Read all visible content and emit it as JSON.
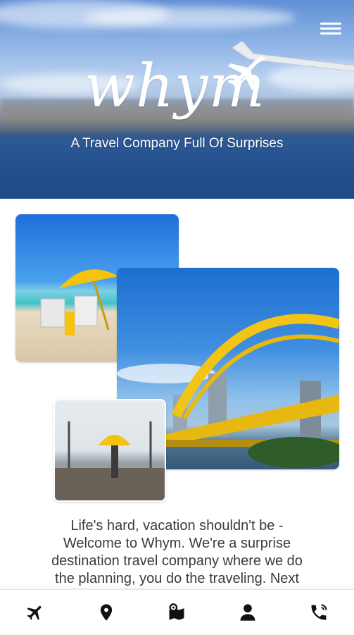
{
  "header": {
    "logo_text": "whym",
    "tagline": "A Travel Company Full Of Surprises",
    "menu_icon": "hamburger-menu-icon"
  },
  "gallery": {
    "images": [
      "beach-umbrella-photo",
      "yellow-bridge-photo",
      "pier-yellow-umbrella-photo"
    ]
  },
  "intro": {
    "lines": [
      "Life's hard, vacation shouldn't be -",
      "Welcome to Whym. We're a surprise",
      "destination travel company where we do",
      "the planning, you do the traveling. Next"
    ]
  },
  "bottom_nav": {
    "items": [
      "plane-icon",
      "location-pin-icon",
      "map-location-icon",
      "person-icon",
      "phone-icon"
    ]
  },
  "colors": {
    "brand_white": "#ffffff",
    "text": "#3b3b3b",
    "icon": "#111111"
  }
}
